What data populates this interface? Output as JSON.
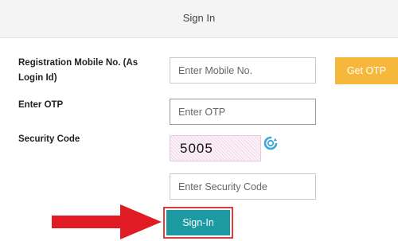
{
  "header": {
    "title": "Sign In"
  },
  "form": {
    "mobile_label": "Registration Mobile No. (As Login Id)",
    "mobile_placeholder": "Enter Mobile No.",
    "get_otp_label": "Get OTP",
    "otp_label": "Enter OTP",
    "otp_placeholder": "Enter OTP",
    "security_label": "Security Code",
    "captcha_code": "5005",
    "security_placeholder": "Enter Security Code",
    "signin_label": "Sign-In"
  },
  "colors": {
    "accent_orange": "#f6b83a",
    "signin_teal": "#1c9aa1",
    "highlight_red": "#e23b3b",
    "refresh_blue": "#3aa7d8"
  },
  "icons": {
    "refresh": "refresh-icon",
    "arrow": "pointer-arrow"
  }
}
